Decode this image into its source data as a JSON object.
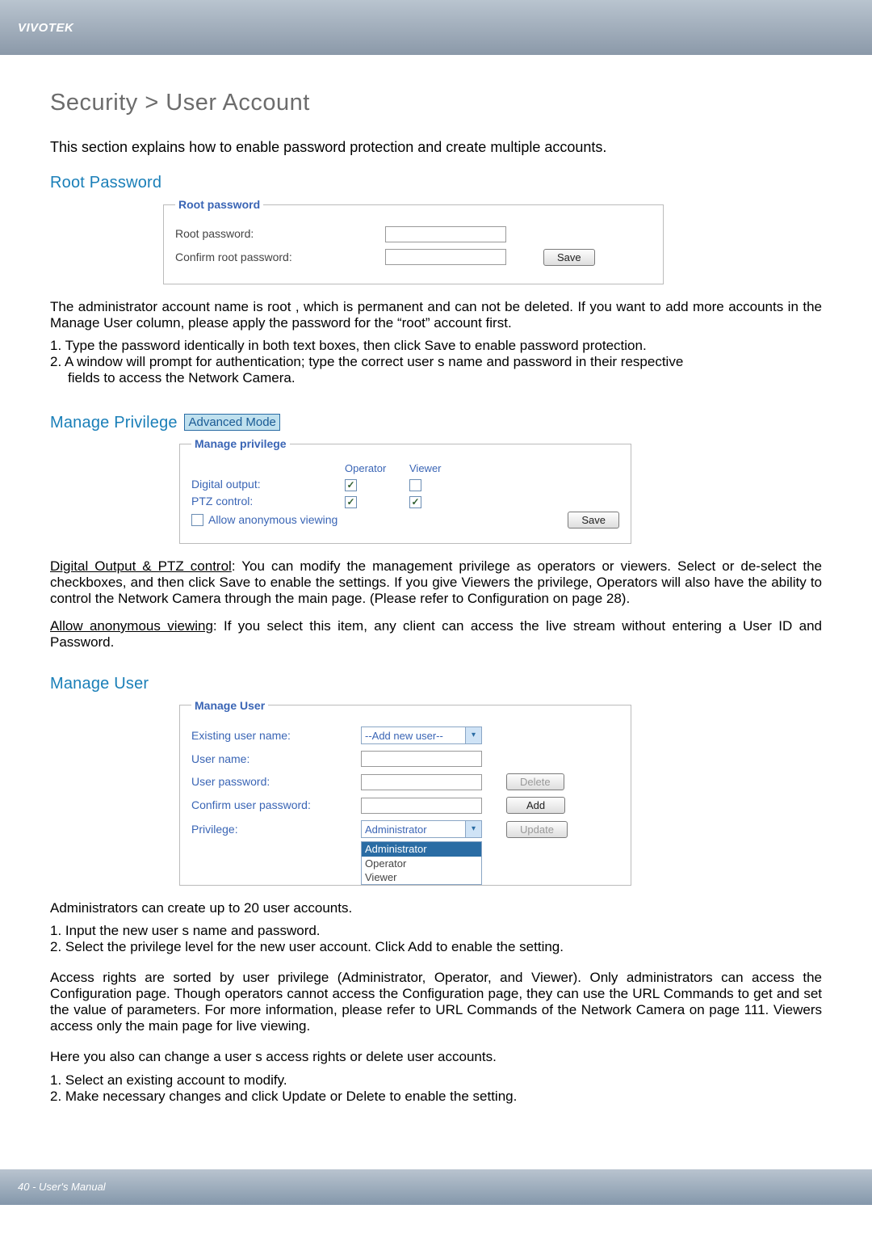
{
  "brand": "VIVOTEK",
  "footer": "40 - User's Manual",
  "page": {
    "title": "Security > User Account",
    "intro": "This section explains how to enable password protection and create multiple accounts."
  },
  "root_password": {
    "section_title": "Root Password",
    "legend": "Root password",
    "label_root": "Root password:",
    "label_confirm": "Confirm root password:",
    "save": "Save",
    "para": "The administrator account name is  root , which is permanent and can not be deleted. If you want to add more accounts in the Manage User column, please apply the password for the “root” account first.",
    "step1": "1. Type the password identically in both text boxes, then click Save to enable password protection.",
    "step2": "2. A window will prompt for authentication; type the correct user s name and password in their respective",
    "step2b": "fields to access the Network Camera."
  },
  "manage_privilege": {
    "section_title": "Manage Privilege",
    "adv_mode": "Advanced Mode",
    "legend": "Manage privilege",
    "col_operator": "Operator",
    "col_viewer": "Viewer",
    "row_digital": "Digital output:",
    "row_ptz": "PTZ control:",
    "row_anon": "Allow anonymous viewing",
    "save": "Save",
    "para1_a": "Digital Output & PTZ control",
    "para1_b": ": You can modify the management privilege as operators or viewers. Select or de-select the checkboxes, and then click Save to enable the settings. If you give Viewers the privilege, Operators will also have the ability to control the Network Camera through the main page. (Please refer to Configuration on page 28).",
    "para2_a": "Allow anonymous viewing",
    "para2_b": ": If you select this item, any client can access the live stream without entering a User ID and Password."
  },
  "manage_user": {
    "section_title": "Manage User",
    "legend": "Manage User",
    "label_existing": "Existing user name:",
    "existing_value": "--Add new user--",
    "label_username": "User name:",
    "label_password": "User password:",
    "label_confirm": "Confirm user password:",
    "label_privilege": "Privilege:",
    "privilege_value": "Administrator",
    "btn_delete": "Delete",
    "btn_add": "Add",
    "btn_update": "Update",
    "options": {
      "o1": "Administrator",
      "o2": "Operator",
      "o3": "Viewer"
    },
    "para1": "Administrators can create up to 20 user accounts.",
    "step1": "1. Input the new user s name and password.",
    "step2": "2. Select the privilege level for the new user account. Click Add to enable the setting.",
    "para2": "Access rights are sorted by user privilege (Administrator, Operator, and Viewer). Only administrators can access the Configuration page. Though operators cannot access the Configuration page, they can use the URL Commands to get and set the value of parameters. For more information, please refer to URL Commands of the Network Camera on page 111. Viewers access only the main page for live viewing.",
    "para3": "Here you also can change a user s access rights or delete user accounts.",
    "step3": "1. Select an existing account to modify.",
    "step4": "2. Make necessary changes and click Update or Delete to enable the setting."
  }
}
